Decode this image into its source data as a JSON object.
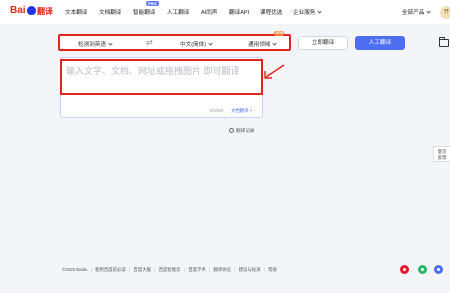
{
  "nav": {
    "logo_text": "Bai",
    "logo_suffix": "翻译",
    "items": [
      "文本翻译",
      "文档翻译",
      "智能翻译",
      "人工翻译",
      "AI同声",
      "翻译API",
      "课程优选",
      "企业服务"
    ],
    "pro_badge": "PRO",
    "all_products": "全部产品",
    "avatar": "开"
  },
  "toolbar": {
    "source_lang": "检测到英语",
    "target_lang": "中文(简体)",
    "domain": "通用领域",
    "new_badge": "NEW",
    "instant_button": "立即翻译",
    "human_button": "人工翻译"
  },
  "input": {
    "placeholder": "输入文字、文档、网址或拖拽图片 即可翻译",
    "char_count": "0/1000",
    "doc_translate": "文档翻译 >"
  },
  "history": "翻译记录",
  "feedback": [
    "意见",
    "反馈"
  ],
  "footer": [
    "©2025 Baidu",
    "使用百度前必读",
    "百度大脑",
    "百度智能云",
    "百度学术",
    "翻译协议",
    "建议与投诉",
    "帮助"
  ],
  "colors": {
    "accent": "#4e6ef2",
    "highlight": "#e1251b",
    "brand_red": "#e1251b"
  },
  "icons": [
    "swap-icon",
    "folder-icon",
    "history-icon",
    "weibo-icon",
    "wechat-icon",
    "chat-icon"
  ]
}
